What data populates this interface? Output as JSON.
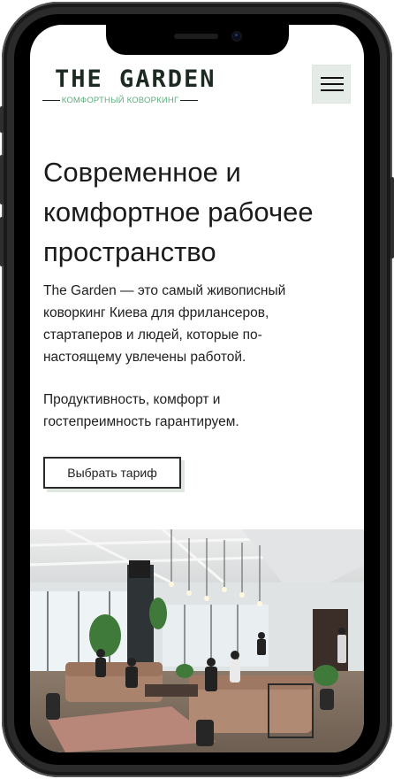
{
  "brand": {
    "title": "THE GARDEN",
    "subtitle": "КОМФОРТНЫЙ КОВОРКИНГ"
  },
  "nav": {
    "menu_icon": "hamburger-menu-icon"
  },
  "hero": {
    "headline": "Современное и комфортное рабочее пространство",
    "paragraph_1": "The Garden — это самый живописный коворкинг Киева для фрилансеров, стартаперов и людей, которые по-настоящему увлечены работой.",
    "paragraph_2": "Продуктивность, комфорт и гостепреимность гарантируем.",
    "cta_label": "Выбрать тариф"
  },
  "colors": {
    "brand_dark": "#1d2a22",
    "brand_green": "#5fae7e",
    "menu_bg": "#e5ebe6",
    "cta_shadow": "#dfe7e0"
  }
}
